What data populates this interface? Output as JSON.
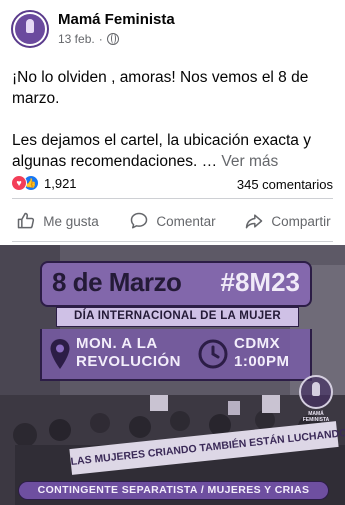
{
  "post": {
    "author": "Mamá Feminista",
    "date": "13 feb.",
    "separator": "·",
    "privacy_icon": "globe-icon",
    "text_line1": "¡No lo olviden , amoras! Nos vemos el 8 de marzo.",
    "text_line2": "Les dejamos el cartel, la ubicación exacta y algunas recomendaciones. …",
    "see_more": "Ver más"
  },
  "stats": {
    "reaction_icons": [
      "love-icon",
      "like-icon"
    ],
    "reactions_count": "1,921",
    "comments": "345 comentarios"
  },
  "actions": {
    "like": "Me gusta",
    "comment": "Comentar",
    "share": "Compartir"
  },
  "poster": {
    "date": "8 de Marzo",
    "hashtag": "#8M23",
    "subtitle": "DÍA INTERNACIONAL DE LA MUJER",
    "place_line1": "MON. A LA",
    "place_line2": "REVOLUCIÓN",
    "city": "CDMX",
    "time": "1:00PM",
    "seal_text": "MAMÁ FEMINISTA",
    "banner": "LAS MUJERES CRIANDO TAMBIÉN ESTÁN LUCHANDO",
    "footer": "CONTINGENTE SEPARATISTA / MUJERES Y CRIAS"
  },
  "colors": {
    "brand_purple": "#6e4fa0",
    "like_blue": "#1877f2",
    "love_red": "#f33e58",
    "muted_text": "#65676b"
  }
}
